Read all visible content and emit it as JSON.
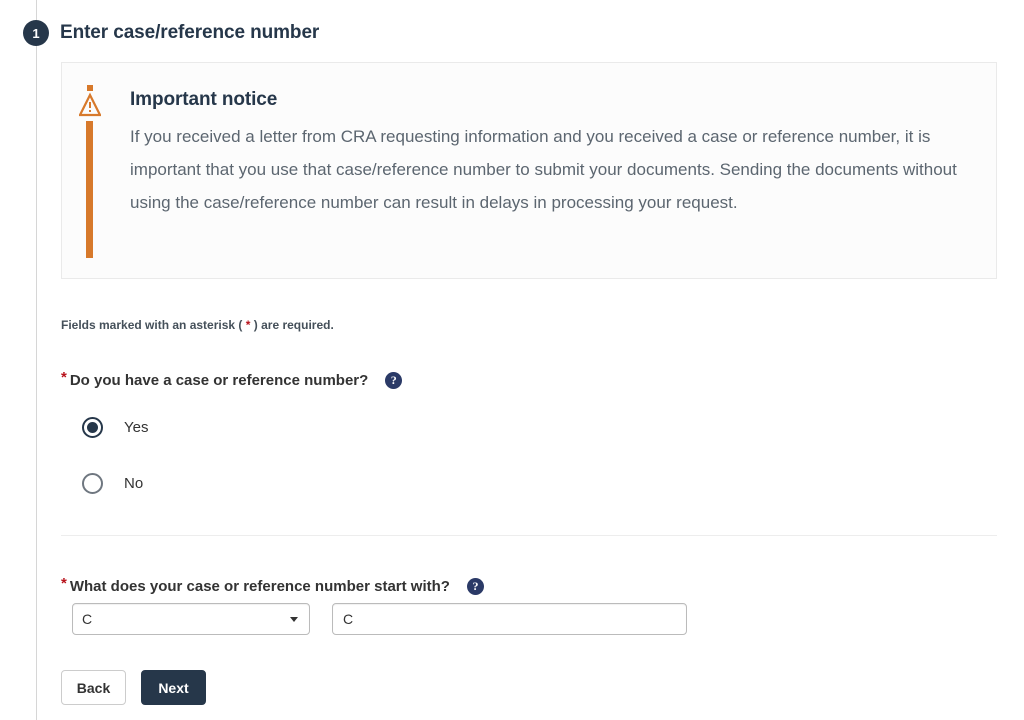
{
  "step": {
    "number": "1",
    "title": "Enter case/reference number"
  },
  "notice": {
    "icon": "warning-triangle-icon",
    "heading": "Important notice",
    "text": "If you received a letter from CRA requesting information and you received a case or reference number, it is important that you use that case/reference number to submit your documents. Sending the documents without using the case/reference number can result in delays in processing your request.",
    "accent_color": "#d7792b",
    "background": "#fcfcfc"
  },
  "required_legend": {
    "prefix": "Fields marked with an asterisk (",
    "asterisk": "*",
    "suffix": ") are required."
  },
  "question1": {
    "asterisk": "*",
    "label": "Do you have a case or reference number?",
    "help_icon": "?",
    "options": [
      {
        "label": "Yes",
        "selected": true
      },
      {
        "label": "No",
        "selected": false
      }
    ]
  },
  "question2": {
    "asterisk": "*",
    "label": "What does your case or reference number start with?",
    "help_icon": "?",
    "select": {
      "value": "C",
      "options": [
        "C"
      ]
    },
    "text_field": {
      "value": "C",
      "placeholder": ""
    }
  },
  "buttons": {
    "back": "Back",
    "next": "Next"
  },
  "colors": {
    "brand_navy": "#26374a",
    "accent_orange": "#d7792b",
    "required_red": "#b8121b",
    "help_blue": "#2b3a67"
  }
}
